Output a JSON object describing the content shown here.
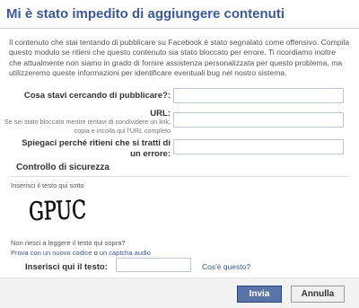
{
  "dialog": {
    "title": "Mi è stato impedito di aggiungere contenuti",
    "intro": "Il contenuto che stai tentando di pubblicare su Facebook è stato segnalato come offensivo. Compila questo modulo se ritieni che questo contenuto sia stato bloccato per errore. Ti ricordiamo inoltre che attualmente non siamo in grado di fornire assistenza personalizzata per questo problema, ma utilizzeremo queste informazioni per identificare eventuali bug nel nostro sistema."
  },
  "form": {
    "q1_label": "Cosa stavi cercando di pubblicare?:",
    "q1_value": "",
    "url_label": "URL:",
    "url_hint": "Se sei stato bloccato mentre tentavi di condividere un link, copia e incolla qui l'URL completo",
    "url_value": "",
    "q3_label": "Spiegaci perché ritieni che si tratti di un errore:",
    "q3_value": ""
  },
  "security": {
    "heading": "Controllo di sicurezza",
    "instruction": "Inserisci il testo qui sotto",
    "captcha_text": "GPUC",
    "cant_read": "Non riesci a leggere il testo qui sopra?",
    "try_label": "Prova con un nuovo codice",
    "or_text": " o ",
    "audio_label": "un captcha audio",
    "input_label": "Inserisci qui il testo:",
    "input_value": "",
    "whats_this": "Cos'è questo?"
  },
  "buttons": {
    "submit": "Invia",
    "cancel": "Annulla"
  },
  "colors": {
    "brand": "#3b5998",
    "primary_button": "#5b74a8"
  }
}
